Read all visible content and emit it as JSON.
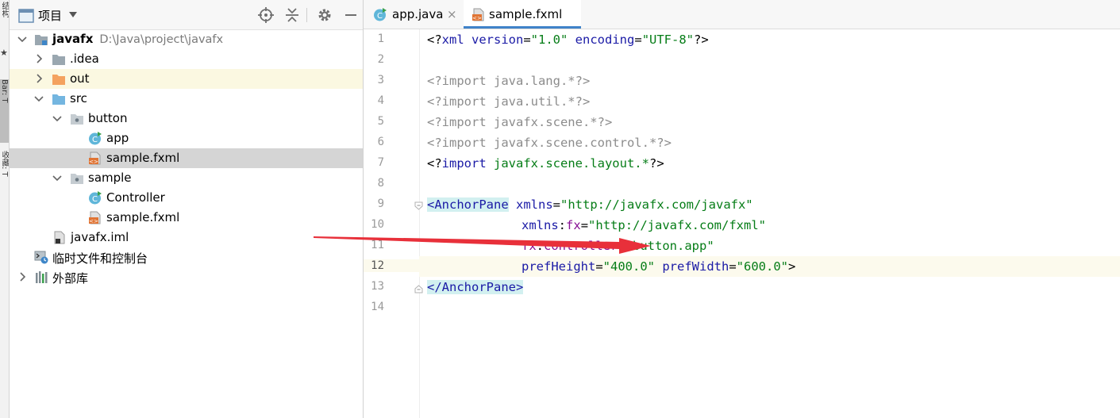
{
  "side_strip": {
    "tab1": "结构",
    "tab2": "Bar: T",
    "tab3": "收藏: T"
  },
  "project_panel": {
    "title": "项目",
    "tree": [
      {
        "label": "javafx",
        "hint": "D:\\Java\\project\\javafx"
      },
      {
        "label": ".idea"
      },
      {
        "label": "out"
      },
      {
        "label": "src"
      },
      {
        "label": "button"
      },
      {
        "label": "app"
      },
      {
        "label": "sample.fxml"
      },
      {
        "label": "sample"
      },
      {
        "label": "Controller"
      },
      {
        "label": "sample.fxml"
      },
      {
        "label": "javafx.iml"
      },
      {
        "label": "临时文件和控制台"
      },
      {
        "label": "外部库"
      }
    ]
  },
  "editor": {
    "tabs": [
      {
        "label": "app.java",
        "close": "×"
      },
      {
        "label": "sample.fxml"
      }
    ],
    "line_numbers": [
      "1",
      "2",
      "3",
      "4",
      "5",
      "6",
      "7",
      "8",
      "9",
      "10",
      "11",
      "12",
      "13",
      "14"
    ],
    "code": {
      "l1": {
        "a": "<?",
        "b": "xml",
        "c": " version",
        "d": "=",
        "e": "\"1.0\"",
        "f": " encoding",
        "g": "=",
        "h": "\"UTF-8\"",
        "i": "?>"
      },
      "l3": "<?import java.lang.*?>",
      "l4": "<?import java.util.*?>",
      "l5": "<?import javafx.scene.*?>",
      "l6": "<?import javafx.scene.control.*?>",
      "l7": {
        "a": "<?",
        "b": "import",
        "c": " javafx.scene.layout.*",
        "d": "?>"
      },
      "l9": {
        "a": "<",
        "b": "AnchorPane",
        "c": " xmlns",
        "d": "=",
        "e": "\"http://javafx.com/javafx\""
      },
      "l10": {
        "a": "xmlns",
        "b": ":",
        "c": "fx",
        "d": "=",
        "e": "\"http://javafx.com/fxml\""
      },
      "l11": {
        "a": "fx",
        "b": ":",
        "c": "controller",
        "d": "=",
        "e": "\"button.app\""
      },
      "l12": {
        "a": "prefHeight",
        "b": "=",
        "c": "\"400.0\"",
        "d": " prefWidth",
        "e": "=",
        "f": "\"600.0\"",
        "g": ">"
      },
      "l13": {
        "a": "</",
        "b": "AnchorPane",
        "c": ">"
      }
    }
  },
  "colors": {
    "accent": "#4083c9",
    "arrow": "#e8303a",
    "tag_bg": "#d2f0f0",
    "string": "#067d17",
    "keyword": "#1a1aa6",
    "namespace": "#871094"
  }
}
